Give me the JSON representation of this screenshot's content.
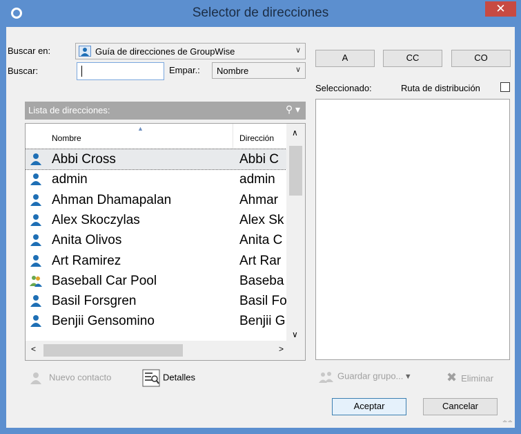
{
  "window": {
    "title": "Selector de direcciones",
    "close_symbol": "✕"
  },
  "search": {
    "look_in_label": "Buscar en:",
    "look_in_value": "Guía de direcciones de GroupWise",
    "search_label": "Buscar:",
    "search_value": "",
    "match_label": "Empar.:",
    "match_value": "Nombre"
  },
  "list": {
    "header_label": "Lista de direcciones:",
    "columns": [
      "Nombre",
      "Dirección"
    ],
    "rows": [
      {
        "name": "Abbi Cross",
        "address": "Abbi C",
        "type": "person",
        "selected": true
      },
      {
        "name": "admin",
        "address": "admin",
        "type": "person"
      },
      {
        "name": "Ahman Dhamapalan",
        "address": "Ahmar",
        "type": "person"
      },
      {
        "name": "Alex Skoczylas",
        "address": "Alex Sk",
        "type": "person"
      },
      {
        "name": "Anita Olivos",
        "address": "Anita C",
        "type": "person"
      },
      {
        "name": "Art Ramirez",
        "address": "Art Rar",
        "type": "person"
      },
      {
        "name": "Baseball Car Pool",
        "address": "Baseba",
        "type": "group"
      },
      {
        "name": "Basil Forsgren",
        "address": "Basil Fo",
        "type": "person"
      },
      {
        "name": "Benjii Gensomino",
        "address": "Benjii G",
        "type": "person"
      }
    ]
  },
  "recipient_buttons": [
    "A",
    "CC",
    "CO"
  ],
  "selected_label": "Seleccionado:",
  "routing_label": "Ruta de distribución",
  "actions": {
    "new_contact": "Nuevo contacto",
    "details": "Detalles",
    "save_group": "Guardar grupo...",
    "delete": "Eliminar",
    "ok": "Aceptar",
    "cancel": "Cancelar"
  },
  "colors": {
    "titlebar": "#5c8fcf",
    "close": "#c74a42",
    "person_icon": "#1e6fb5",
    "group_icon": "#6aa84f"
  }
}
